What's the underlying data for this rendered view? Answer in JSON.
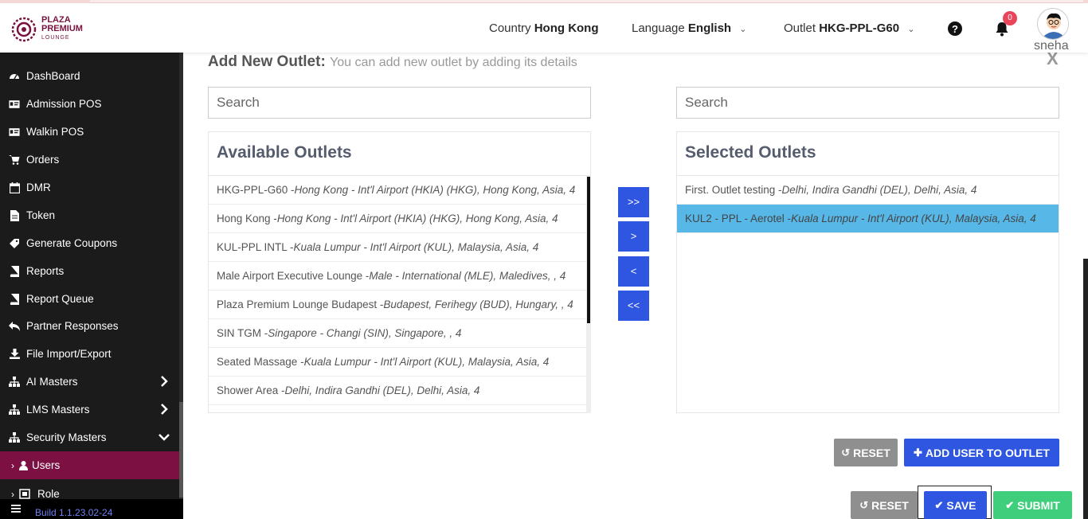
{
  "header": {
    "logo": {
      "line1": "PLAZA",
      "line2": "PREMIUM",
      "line3": "LOUNGE"
    },
    "country_label": "Country",
    "country_value": "Hong Kong",
    "language_label": "Language",
    "language_value": "English",
    "outlet_label": "Outlet",
    "outlet_value": "HKG-PPL-G60",
    "notifications_count": "0",
    "username": "sneha"
  },
  "sidebar": {
    "items": [
      {
        "label": "DashBoard",
        "icon": "dashboard-icon"
      },
      {
        "label": "Admission POS",
        "icon": "id-card-icon"
      },
      {
        "label": "Walkin POS",
        "icon": "id-card-icon"
      },
      {
        "label": "Orders",
        "icon": "cart-icon"
      },
      {
        "label": "DMR",
        "icon": "calendar-icon"
      },
      {
        "label": "Token",
        "icon": "document-icon"
      },
      {
        "label": "Generate Coupons",
        "icon": "tag-icon"
      },
      {
        "label": "Reports",
        "icon": "book-icon"
      },
      {
        "label": "Report Queue",
        "icon": "book-icon"
      },
      {
        "label": "Partner Responses",
        "icon": "reply-icon"
      },
      {
        "label": "File Import/Export",
        "icon": "download-icon"
      },
      {
        "label": "AI Masters",
        "icon": "sitemap-icon"
      },
      {
        "label": "LMS Masters",
        "icon": "sitemap-icon"
      },
      {
        "label": "Security Masters",
        "icon": "sitemap-icon"
      },
      {
        "label": "Users",
        "icon": "user-icon"
      },
      {
        "label": "Role",
        "icon": "role-icon"
      }
    ],
    "build": "Build 1.1.23.02-24"
  },
  "main": {
    "title": "Add New Outlet:",
    "subtitle": "You can add new outlet by adding its details",
    "close": "X",
    "left_search_placeholder": "Search",
    "right_search_placeholder": "Search",
    "available_title": "Available Outlets",
    "selected_title": "Selected Outlets",
    "available": [
      {
        "name": "HKG-PPL-G60 -",
        "detail": "Hong Kong - Int'l Airport (HKIA) (HKG), Hong Kong, Asia, 4"
      },
      {
        "name": "Hong Kong -",
        "detail": "Hong Kong - Int'l Airport (HKIA) (HKG), Hong Kong, Asia, 4"
      },
      {
        "name": "KUL-PPL INTL -",
        "detail": "Kuala Lumpur - Int'l Airport (KUL), Malaysia, Asia, 4"
      },
      {
        "name": "Male Airport Executive Lounge -",
        "detail": "Male - International (MLE), Maledives, , 4"
      },
      {
        "name": "Plaza Premium Lounge Budapest -",
        "detail": "Budapest, Ferihegy (BUD), Hungary, , 4"
      },
      {
        "name": "SIN TGM -",
        "detail": "Singapore - Changi (SIN), Singapore, , 4"
      },
      {
        "name": "Seated Massage -",
        "detail": "Kuala Lumpur - Int'l Airport (KUL), Malaysia, Asia, 4"
      },
      {
        "name": "Shower Area -",
        "detail": "Delhi, Indira Gandhi (DEL), Delhi, Asia, 4"
      }
    ],
    "selected": [
      {
        "name": "First. Outlet testing -",
        "detail": "Delhi, Indira Gandhi (DEL), Delhi, Asia, 4"
      },
      {
        "name": "KUL2 - PPL - Aerotel -",
        "detail": "Kuala Lumpur - Int'l Airport (KUL), Malaysia, Asia, 4"
      }
    ],
    "move_all_right": ">>",
    "move_right": ">",
    "move_left": "<",
    "move_all_left": "<<",
    "reset_inner": "RESET",
    "add_user": "ADD USER TO OUTLET",
    "reset": "RESET",
    "save": "SAVE",
    "submit": "SUBMIT"
  },
  "colors": {
    "sidebar_bg": "#1b1b1b",
    "sidebar_active": "#7c1042",
    "primary_blue": "#2f56e0",
    "selected_row": "#57b8e8",
    "submit_green": "#3fcf7c",
    "reset_grey": "#8f8f8f"
  }
}
